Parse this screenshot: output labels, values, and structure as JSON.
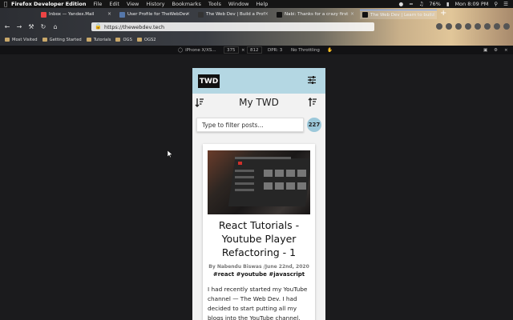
{
  "menubar": {
    "app": "Firefox Developer Edition",
    "items": [
      "File",
      "Edit",
      "View",
      "History",
      "Bookmarks",
      "Tools",
      "Window",
      "Help"
    ],
    "battery": "76%",
    "clock": "Mon 8:09 PM"
  },
  "tabs": [
    {
      "label": "Inbox — Yandex.Mail"
    },
    {
      "label": "User Profile for TheWebDev"
    },
    {
      "label": "The Web Dev | Build a Prof"
    },
    {
      "label": "Nabi: Thanks for a crazy first"
    },
    {
      "label": "The Web Dev | Learn to build"
    }
  ],
  "url": "https://thewebdev.tech",
  "bookmarks": [
    "Most Visited",
    "Getting Started",
    "Tutorials",
    "OGS",
    "OGS2"
  ],
  "devtools": {
    "device": "iPhone X/XS...",
    "width": "375",
    "height": "812",
    "dpr": "DPR: 3",
    "throttle": "No Throttling"
  },
  "site": {
    "logo": "TWD",
    "title": "My TWD",
    "filter_placeholder": "Type to filter posts...",
    "count": "227",
    "post": {
      "title": "React Tutorials - Youtube Player Refactoring - 1",
      "meta": "By Nabendu Biswas /June 22nd, 2020",
      "tags": "#react #youtube #javascript",
      "excerpt": "I had recently started my YouTube channel — The Web Dev. I had decided to start putting all my blogs into the YouTube channel."
    }
  },
  "colors": {
    "header_bg": "#b4d7e3",
    "count_badge": "#9cc8da",
    "page_bg": "#1b1b1d"
  }
}
